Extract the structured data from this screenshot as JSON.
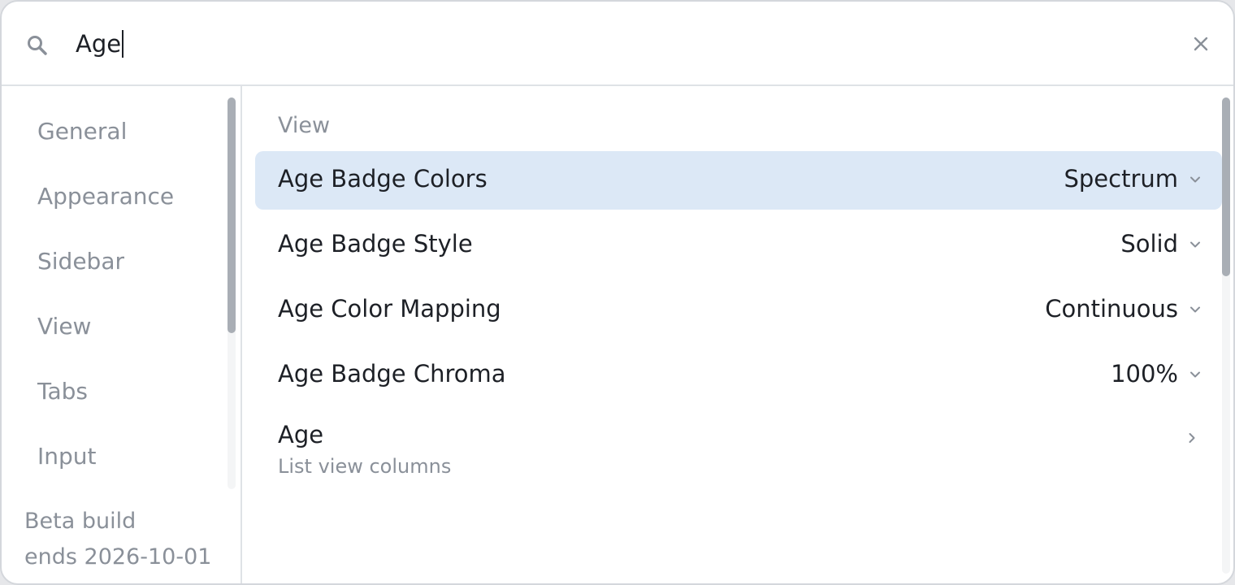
{
  "search": {
    "value": "Age"
  },
  "sidebar": {
    "items": [
      {
        "label": "General"
      },
      {
        "label": "Appearance"
      },
      {
        "label": "Sidebar"
      },
      {
        "label": "View"
      },
      {
        "label": "Tabs"
      },
      {
        "label": "Input"
      }
    ],
    "footer_line1": "Beta build",
    "footer_line2": "ends 2026-10-01"
  },
  "main": {
    "section_title": "View",
    "rows": [
      {
        "label": "Age Badge Colors",
        "value": "Spectrum",
        "selected": true
      },
      {
        "label": "Age Badge Style",
        "value": "Solid"
      },
      {
        "label": "Age Color Mapping",
        "value": "Continuous"
      },
      {
        "label": "Age Badge Chroma",
        "value": "100%"
      },
      {
        "label": "Age",
        "subtitle": "List view columns"
      }
    ]
  },
  "colors": {
    "selection": "#dce8f6",
    "muted_text": "#8a9099",
    "primary_text": "#1d2026"
  },
  "icons": {
    "search": "search-icon",
    "close": "close-icon",
    "dropdown": "chevron-down-icon",
    "navigate": "chevron-right-icon"
  }
}
